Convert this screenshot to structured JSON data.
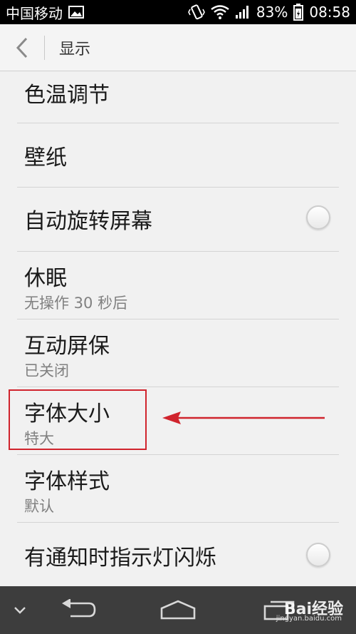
{
  "status_bar": {
    "carrier": "中国移动",
    "battery": "83%",
    "time": "08:58",
    "icons": [
      "image-icon",
      "vibrate-icon",
      "wifi-icon",
      "signal-icon",
      "battery-icon"
    ]
  },
  "header": {
    "title": "显示",
    "back_icon": "back-chevron-icon"
  },
  "settings": {
    "items": [
      {
        "title": "色温调节"
      },
      {
        "title": "壁纸"
      },
      {
        "title": "自动旋转屏幕",
        "toggle": false
      },
      {
        "title": "休眠",
        "subtitle": "无操作 30 秒后"
      },
      {
        "title": "互动屏保",
        "subtitle": "已关闭"
      },
      {
        "title": "字体大小",
        "subtitle": "特大"
      },
      {
        "title": "字体样式",
        "subtitle": "默认"
      },
      {
        "title": "有通知时指示灯闪烁",
        "toggle": false
      }
    ]
  },
  "annotation": {
    "color": "#d0242d"
  },
  "nav_bar": {
    "buttons": [
      "collapse-icon",
      "back-icon",
      "home-icon",
      "recent-apps-icon"
    ]
  },
  "watermark": {
    "text": "Bai经验",
    "url": "jingyan.baidu.com"
  }
}
